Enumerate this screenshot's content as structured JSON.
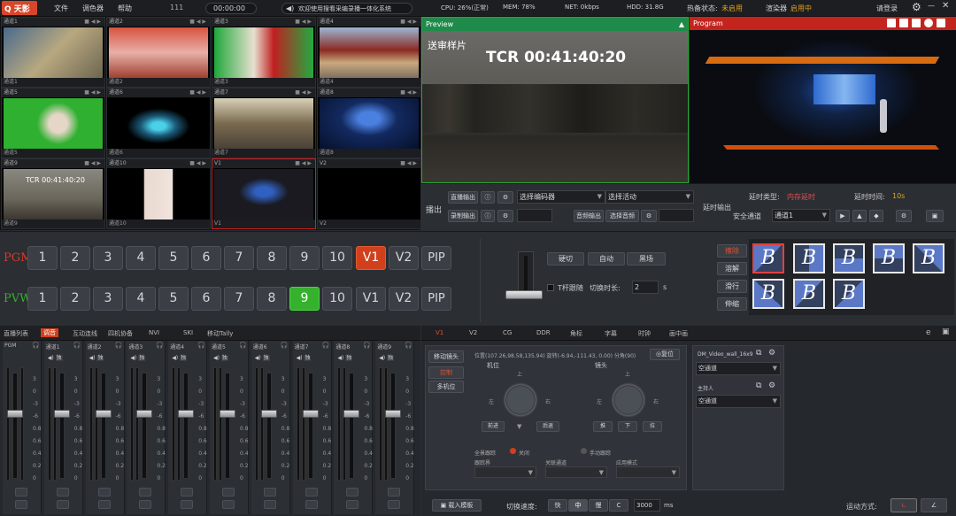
{
  "topbar": {
    "logo": "Q 天影",
    "menu": [
      "文件",
      "调色器",
      "帮助"
    ],
    "counter": "111",
    "timecode": "00:00:00",
    "marquee": "欢迎使用搜看采编录播一体化系统",
    "cpu": "CPU: 26%(正常)",
    "mem": "MEM: 78%",
    "net": "NET: 0kbps",
    "hdd": "HDD: 31.8G",
    "hotstate_label": "热备状态:",
    "hotstate_value": "未启用",
    "renderer_label": "渲染器",
    "renderer_value": "启用中",
    "login": "请登录"
  },
  "multiview": {
    "cells": [
      {
        "label": "通道1",
        "footer": "通道1"
      },
      {
        "label": "通道2",
        "footer": "通道2"
      },
      {
        "label": "通道3",
        "footer": "通道3"
      },
      {
        "label": "通道4",
        "footer": "通道4"
      },
      {
        "label": "通道5",
        "footer": "通道5"
      },
      {
        "label": "通道6",
        "footer": "通道6"
      },
      {
        "label": "通道7",
        "footer": "通道7"
      },
      {
        "label": "通道8",
        "footer": "通道8"
      },
      {
        "label": "通道9",
        "footer": "通道9"
      },
      {
        "label": "通道10",
        "footer": "通道10"
      },
      {
        "label": "V1",
        "footer": "V1"
      },
      {
        "label": "V2",
        "footer": "V2"
      }
    ],
    "cell9_overlay": "TCR 00:41:40:20"
  },
  "preview": {
    "title": "Preview",
    "caption": "送审样片",
    "tcr": "TCR 00:41:40:20"
  },
  "program": {
    "title": "Program"
  },
  "stream": {
    "label": "播出",
    "live_out": "直播输出",
    "record_out": "录制输出",
    "encoder_placeholder": "选择编码器",
    "activity_placeholder": "选择活动",
    "audio_out": "音频输出",
    "audio_select": "选择音频"
  },
  "delay": {
    "label": "延时输出",
    "type_label": "延时类型:",
    "type_value": "内存延时",
    "time_label": "延时时间:",
    "time_value": "10s",
    "safe_label": "安全通道",
    "safe_value": "通道1"
  },
  "switcher": {
    "pgm_label": "PGM",
    "pvw_label": "PVW",
    "pgm_keys": [
      "1",
      "2",
      "3",
      "4",
      "5",
      "6",
      "7",
      "8",
      "9",
      "10",
      "V1",
      "V2",
      "PIP"
    ],
    "pvw_keys": [
      "1",
      "2",
      "3",
      "4",
      "5",
      "6",
      "7",
      "8",
      "9",
      "10",
      "V1",
      "V2",
      "PIP"
    ],
    "pgm_active": "V1",
    "pvw_active": "9",
    "cut": "硬切",
    "auto": "自动",
    "black": "黑场",
    "tbar_follow": "T杆跟随",
    "switch_time_label": "切换时长:",
    "switch_time_value": "2",
    "switch_time_unit": "s",
    "transitions": [
      "擦除",
      "溶解",
      "滑行",
      "伸缩"
    ],
    "transition_active": "擦除",
    "wipe_glyph": "B"
  },
  "audio": {
    "tabs": [
      "直播列表",
      "调音",
      "互动连线",
      "四机协备",
      "NVI",
      "SKI",
      "移动Tally"
    ],
    "active_tab": "调音",
    "channels": [
      "PGM",
      "通道1",
      "通道2",
      "通道3",
      "通道4",
      "通道5",
      "通道6",
      "通道7",
      "通道8",
      "通道9"
    ],
    "scale": [
      "3",
      "0",
      "-3",
      "-6",
      "0.8",
      "0.6",
      "0.4",
      "0.2",
      "0"
    ],
    "solo": "独",
    "mute": "静"
  },
  "vpanel": {
    "tabs": [
      "V1",
      "V2",
      "CG",
      "DDR",
      "角标",
      "字幕",
      "时钟",
      "画中画"
    ],
    "active_tab": "V1",
    "side": [
      "移动镜头",
      "控制",
      "多机位"
    ],
    "side_active": "控制",
    "position_label": "位置(107.26,98.58,135.94) 旋转(-6.94,-111.43, 0.00) 分角(90)",
    "reset": "复位",
    "cam_label": "机位",
    "lens_label": "镜头",
    "up": "上",
    "down": "下",
    "left": "左",
    "right": "右",
    "forward": "前进",
    "back": "后退",
    "tilt_l": "推",
    "tilt_r": "拉",
    "follow_label": "全景跟踪",
    "off_label": "关闭",
    "manual_label": "手动跟踪",
    "track_range": "跟踪界",
    "associate": "关联通道",
    "apply_mode": "应用模式",
    "load_template": "载入模板",
    "speed_label": "切换速度:",
    "speed_opts": [
      "快",
      "中",
      "慢",
      "C"
    ],
    "speed_active": "中",
    "speed_value": "3000",
    "speed_unit": "ms",
    "move_label": "运动方式:",
    "right_panels": [
      {
        "name": "DM_Video_wall_16x9",
        "value": "空通道"
      },
      {
        "name": "主持人",
        "value": "空通道"
      }
    ]
  }
}
